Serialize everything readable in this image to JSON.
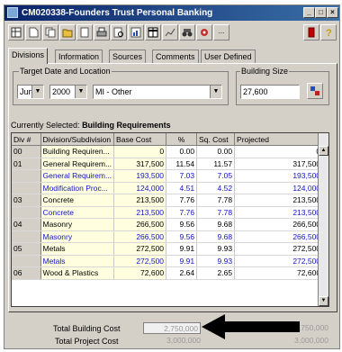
{
  "window": {
    "title": "CM020338-Founders Trust Personal Banking"
  },
  "toolbar": {
    "dropdown_glyph": "..."
  },
  "tabs": [
    "Divisions",
    "Information",
    "Sources",
    "Comments",
    "User Defined"
  ],
  "target": {
    "legend": "Target Date and Location",
    "month": "Jun",
    "year": "2000",
    "location": "MI - Other"
  },
  "building": {
    "legend": "Building Size",
    "value": "27,600"
  },
  "selection": {
    "label": "Currently Selected:",
    "value": "Building Requirements"
  },
  "grid": {
    "columns": [
      "Div #",
      "Division/Subdivision",
      "Base Cost",
      "%",
      "Sq. Cost",
      "Projected"
    ],
    "rows": [
      {
        "div": "00",
        "name": "Building Requiren...",
        "base": "0",
        "pct": "0.00",
        "sq": "0.00",
        "proj": "0",
        "detail": false
      },
      {
        "div": "01",
        "name": "General Requirem...",
        "base": "317,500",
        "pct": "11.54",
        "sq": "11.57",
        "proj": "317,500",
        "detail": false
      },
      {
        "div": "",
        "name": "General Requirem...",
        "base": "193,500",
        "pct": "7.03",
        "sq": "7.05",
        "proj": "193,500",
        "detail": true
      },
      {
        "div": "",
        "name": "Modification Proc...",
        "base": "124,000",
        "pct": "4.51",
        "sq": "4.52",
        "proj": "124,000",
        "detail": true
      },
      {
        "div": "03",
        "name": "Concrete",
        "base": "213,500",
        "pct": "7.76",
        "sq": "7.78",
        "proj": "213,500",
        "detail": false
      },
      {
        "div": "",
        "name": "Concrete",
        "base": "213,500",
        "pct": "7.76",
        "sq": "7.78",
        "proj": "213,500",
        "detail": true
      },
      {
        "div": "04",
        "name": "Masonry",
        "base": "266,500",
        "pct": "9.56",
        "sq": "9.68",
        "proj": "266,500",
        "detail": false
      },
      {
        "div": "",
        "name": "Masonry",
        "base": "266,500",
        "pct": "9.56",
        "sq": "9.68",
        "proj": "266,500",
        "detail": true
      },
      {
        "div": "05",
        "name": "Metals",
        "base": "272,500",
        "pct": "9.91",
        "sq": "9.93",
        "proj": "272,500",
        "detail": false
      },
      {
        "div": "",
        "name": "Metals",
        "base": "272,500",
        "pct": "9.91",
        "sq": "9.93",
        "proj": "272,500",
        "detail": true
      },
      {
        "div": "06",
        "name": "Wood & Plastics",
        "base": "72,600",
        "pct": "2.64",
        "sq": "2.65",
        "proj": "72,600",
        "detail": false
      }
    ]
  },
  "totals": {
    "building_label": "Total Building Cost",
    "building_value": "2,750,000",
    "building_right": "2,750,000",
    "project_label": "Total Project Cost",
    "project_value": "3,000,000",
    "project_right": "3,000,000"
  },
  "annotation": {
    "arrow_color": "#000000"
  }
}
